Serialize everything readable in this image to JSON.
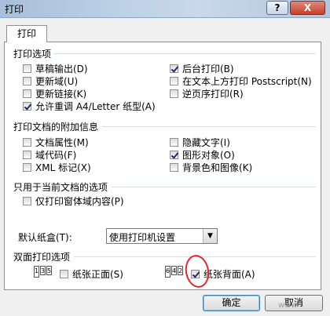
{
  "window": {
    "title": "打印",
    "help_label": "?",
    "close_label": "X"
  },
  "tab": {
    "label": "打印"
  },
  "print_options": {
    "title": "打印选项",
    "items": [
      {
        "label": "草稿输出(D)",
        "checked": false
      },
      {
        "label": "更新域(U)",
        "checked": false
      },
      {
        "label": "更新链接(K)",
        "checked": false
      },
      {
        "label": "允许重调 A4/Letter 纸型(A)",
        "checked": true
      },
      {
        "label": "后台打印(B)",
        "checked": true
      },
      {
        "label": "在文本上方打印 Postscript(N)",
        "checked": false
      },
      {
        "label": "逆页序打印(R)",
        "checked": false
      }
    ]
  },
  "additional_info": {
    "title": "打印文档的附加信息",
    "items": [
      {
        "label": "文档属性(M)",
        "checked": false
      },
      {
        "label": "域代码(F)",
        "checked": false
      },
      {
        "label": "XML 标记(X)",
        "checked": false
      },
      {
        "label": "隐藏文字(I)",
        "checked": false
      },
      {
        "label": "图形对象(O)",
        "checked": true
      },
      {
        "label": "背景色和图像(K)",
        "checked": false
      }
    ]
  },
  "current_doc": {
    "title": "只用于当前文档的选项",
    "items": [
      {
        "label": "仅打印窗体域内容(P)",
        "checked": false
      }
    ]
  },
  "tray": {
    "label": "默认纸盒(T):",
    "value": "使用打印机设置"
  },
  "duplex": {
    "title": "双面打印选项",
    "front_icon": [
      "1",
      "3",
      "5"
    ],
    "back_icon": [
      "6",
      "4",
      "2"
    ],
    "front_label": "纸张正面(S)",
    "front_checked": false,
    "back_label": "纸张背面(A)",
    "back_checked": true
  },
  "buttons": {
    "ok": "确定",
    "cancel": "取消"
  },
  "watermark": "www"
}
